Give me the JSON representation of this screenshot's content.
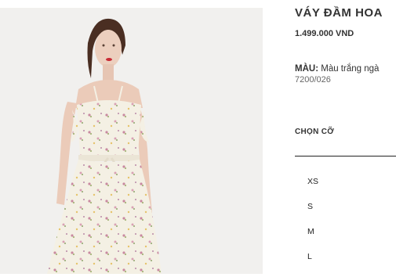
{
  "product": {
    "title": "VÁY ĐẦM HOA",
    "price": "1.499.000 VND",
    "color_label": "MÀU:",
    "color_value": "Màu trắng ngà",
    "reference": "7200/026"
  },
  "sizes": {
    "label": "CHỌN CỠ",
    "options": [
      "XS",
      "S",
      "M",
      "L"
    ]
  },
  "colors": {
    "photo_background": "#f1f0ee",
    "dress": "#f4f0e4",
    "text": "#333333"
  }
}
